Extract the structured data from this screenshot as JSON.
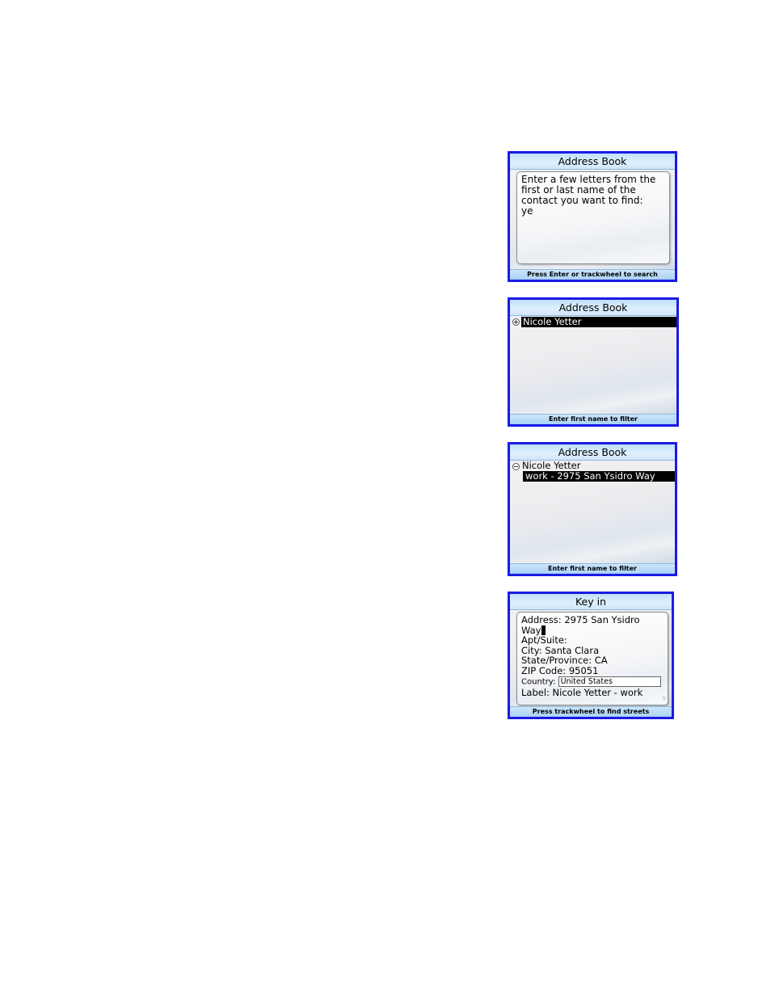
{
  "screen1": {
    "title": "Address Book",
    "prompt": "Enter a few letters from the first or last name of the contact you want to find:",
    "entry": "ye",
    "status": "Press Enter or trackwheel to search"
  },
  "screen2": {
    "title": "Address Book",
    "contact": "Nicole Yetter",
    "status": "Enter first name to filter"
  },
  "screen3": {
    "title": "Address Book",
    "contact": "Nicole Yetter",
    "address_item": "work - 2975 San Ysidro Way",
    "status": "Enter first name to filter"
  },
  "screen4": {
    "title": "Key in",
    "address_line1": "Address: 2975 San Ysidro",
    "address_line2": "Way",
    "apt": "Apt/Suite:",
    "city": "City: Santa Clara",
    "state": "State/Province: CA",
    "zip": "ZIP Code: 95051",
    "country_label": "Country:",
    "country_value": "United States",
    "label": "Label: Nicole Yetter - work",
    "status": "Press trackwheel to find streets"
  },
  "icons": {
    "expand": "expand-icon",
    "collapse": "collapse-icon",
    "scroll": "scroll-down-icon"
  }
}
